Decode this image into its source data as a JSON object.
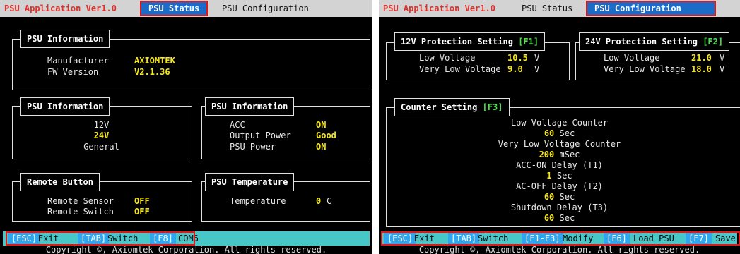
{
  "left": {
    "app_title": "PSU Application Ver1.0",
    "tabs": [
      "PSU Status",
      "PSU Configuration"
    ],
    "info_top": {
      "title": "PSU Information",
      "rows": [
        {
          "label": "Manufacturer",
          "value": "AXIOMTEK"
        },
        {
          "label": "FW Version",
          "value": "V2.1.36"
        }
      ]
    },
    "info_left": {
      "title": "PSU Information",
      "items": [
        {
          "label": "12V",
          "highlight": false
        },
        {
          "label": "24V",
          "highlight": true
        },
        {
          "label": "General",
          "highlight": false
        }
      ]
    },
    "info_right": {
      "title": "PSU Information",
      "rows": [
        {
          "label": "ACC",
          "value": "ON"
        },
        {
          "label": "Output Power",
          "value": "Good"
        },
        {
          "label": "PSU Power",
          "value": "ON"
        }
      ]
    },
    "remote": {
      "title": "Remote Button",
      "rows": [
        {
          "label": "Remote Sensor",
          "value": "OFF"
        },
        {
          "label": "Remote Switch",
          "value": "OFF"
        }
      ]
    },
    "temperature": {
      "title": "PSU Temperature",
      "label": "Temperature",
      "value": "0",
      "unit": "C"
    },
    "bottom_keys": [
      {
        "key": "[ESC]",
        "label": "Exit"
      },
      {
        "key": "[TAB]",
        "label": "Switch"
      },
      {
        "key": "[F8]",
        "label": "COM6"
      }
    ],
    "copyright": "Copyright ©, Axiomtek Corporation. All rights reserved."
  },
  "right": {
    "app_title": "PSU Application Ver1.0",
    "tabs": [
      "PSU Status",
      "PSU Configuration"
    ],
    "prot12": {
      "title": "12V Protection Setting",
      "key": "[F1]",
      "rows": [
        {
          "label": "Low Voltage",
          "value": "10.5",
          "unit": "V"
        },
        {
          "label": "Very Low Voltage",
          "value": "9.0",
          "unit": "V"
        }
      ]
    },
    "prot24": {
      "title": "24V Protection Setting",
      "key": "[F2]",
      "rows": [
        {
          "label": "Low Voltage",
          "value": "21.0",
          "unit": "V"
        },
        {
          "label": "Very Low Voltage",
          "value": "18.0",
          "unit": "V"
        }
      ]
    },
    "counter": {
      "title": "Counter Setting",
      "key": "[F3]",
      "items": [
        {
          "label": "Low Voltage Counter",
          "value": "60",
          "unit": "Sec"
        },
        {
          "label": "Very Low Voltage Counter",
          "value": "200",
          "unit": "mSec"
        },
        {
          "label": "ACC-ON Delay (T1)",
          "value": "1",
          "unit": "Sec"
        },
        {
          "label": "AC-OFF Delay (T2)",
          "value": "60",
          "unit": "Sec"
        },
        {
          "label": "Shutdown Delay (T3)",
          "value": "60",
          "unit": "Sec"
        }
      ]
    },
    "bottom_keys": [
      {
        "key": "[ESC]",
        "label": "Exit"
      },
      {
        "key": "[TAB]",
        "label": "Switch"
      },
      {
        "key": "[F1-F3]",
        "label": "Modify"
      },
      {
        "key": "[F6]",
        "label": "Load PSU"
      },
      {
        "key": "[F7]",
        "label": "Save"
      }
    ],
    "copyright": "Copyright ©, Axiomtek Corporation. All rights reserved."
  },
  "colors": {
    "background": "#000000",
    "title_red": "#e0302c",
    "active_tab": "#1b6cc8",
    "value_yellow": "#f5e61d",
    "key_green": "#4ce04c",
    "status_bar": "#48c7c9",
    "key_blue": "#2ea7ee",
    "highlight_frame": "#e01818"
  }
}
